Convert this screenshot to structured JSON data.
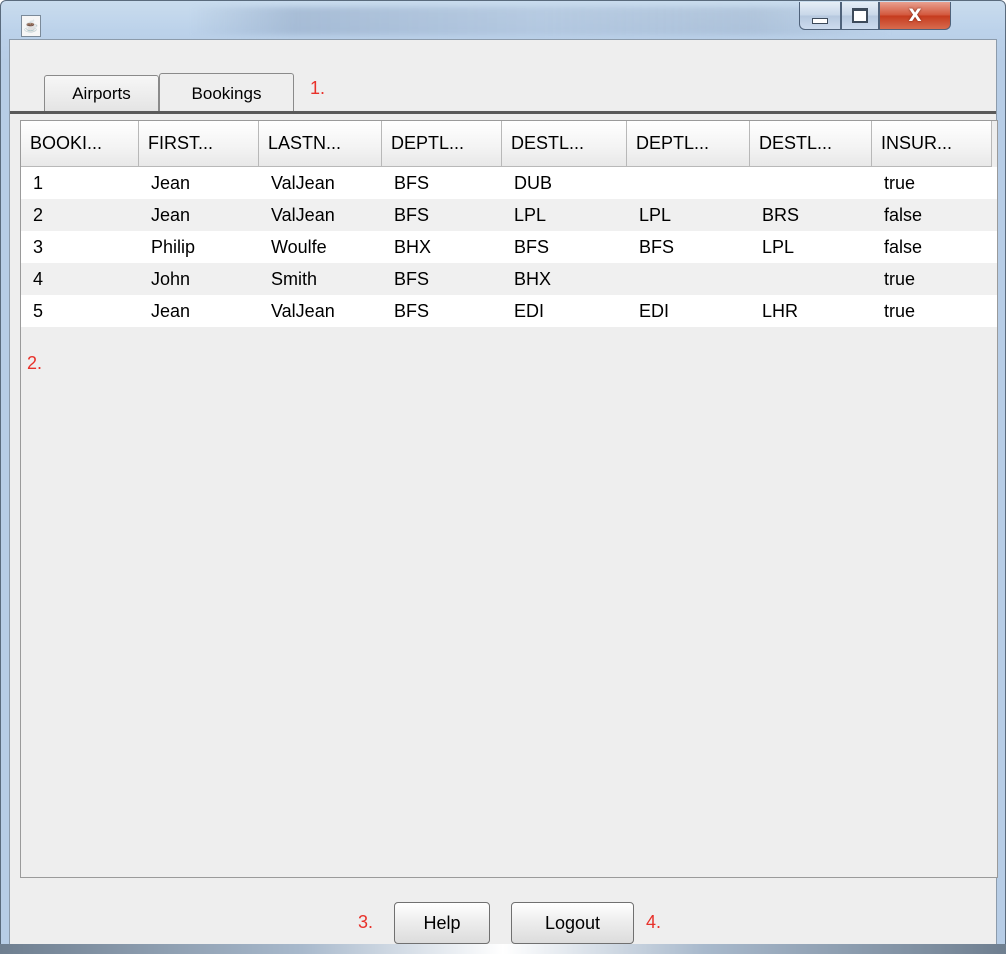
{
  "window": {
    "title": "",
    "icon": "java-icon",
    "controls": {
      "minimize": "minimize-icon",
      "maximize": "maximize-icon",
      "close_label": "X"
    }
  },
  "tabs": [
    {
      "label": "Airports",
      "selected": false
    },
    {
      "label": "Bookings",
      "selected": true
    }
  ],
  "annotations": {
    "a1": "1.",
    "a2": "2.",
    "a3": "3.",
    "a4": "4."
  },
  "table": {
    "columns": [
      "BOOKI...",
      "FIRST...",
      "LASTN...",
      "DEPTL...",
      "DESTL...",
      "DEPTL...",
      "DESTL...",
      "INSUR..."
    ],
    "rows": [
      [
        "1",
        "Jean",
        "ValJean",
        "BFS",
        "DUB",
        "",
        "",
        "true"
      ],
      [
        "2",
        "Jean",
        "ValJean",
        "BFS",
        "LPL",
        "LPL",
        "BRS",
        "false"
      ],
      [
        "3",
        "Philip",
        "Woulfe",
        "BHX",
        "BFS",
        "BFS",
        "LPL",
        "false"
      ],
      [
        "4",
        "John",
        "Smith",
        "BFS",
        "BHX",
        "",
        "",
        "true"
      ],
      [
        "5",
        "Jean",
        "ValJean",
        "BFS",
        "EDI",
        "EDI",
        "LHR",
        "true"
      ]
    ]
  },
  "buttons": {
    "help": "Help",
    "logout": "Logout"
  },
  "colors": {
    "annotation": "#e8312a",
    "close_button": "#c53a1d"
  }
}
